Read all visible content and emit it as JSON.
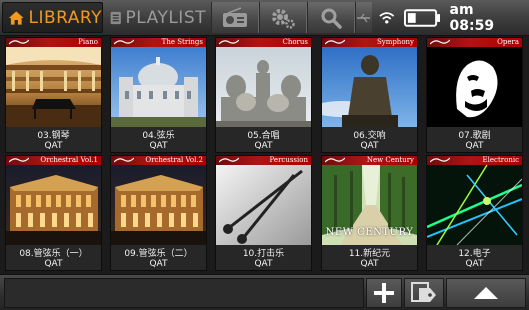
{
  "topbar": {
    "library_label": "LIBRARY",
    "playlist_label": "PLAYLIST",
    "icons": [
      "home-icon",
      "playlist-icon",
      "radio-icon",
      "settings-icon",
      "search-icon",
      "usb-icon"
    ],
    "time": "am 08:59",
    "wifi_icon": "wifi-icon",
    "battery_icon": "battery-icon"
  },
  "albums": [
    {
      "title": "Piano",
      "number": "03.钢琴",
      "artist": "QAT",
      "theme": "concert-hall"
    },
    {
      "title": "The Strings",
      "number": "04.弦乐",
      "artist": "QAT",
      "theme": "palace"
    },
    {
      "title": "Chorus",
      "number": "05.合唱",
      "artist": "QAT",
      "theme": "statues"
    },
    {
      "title": "Symphony",
      "number": "06.交响",
      "artist": "QAT",
      "theme": "statue-sky"
    },
    {
      "title": "Opera",
      "number": "07.歌剧",
      "artist": "QAT",
      "theme": "portrait"
    },
    {
      "title": "Orchestral Vol.1",
      "number": "08.管弦乐（一）",
      "artist": "QAT",
      "theme": "building-night"
    },
    {
      "title": "Orchestral Vol.2",
      "number": "09.管弦乐（二）",
      "artist": "QAT",
      "theme": "building-night"
    },
    {
      "title": "Percussion",
      "number": "10.打击乐",
      "artist": "QAT",
      "theme": "drumsticks"
    },
    {
      "title": "New Century",
      "number": "11.新纪元",
      "artist": "QAT",
      "theme": "forest-path",
      "cover_text": "NEW CENTURY"
    },
    {
      "title": "Electronic",
      "number": "12.电子",
      "artist": "QAT",
      "theme": "neon"
    }
  ],
  "bottombar": {
    "buttons": [
      "add-icon",
      "tag-icon",
      "up-arrow-icon"
    ]
  },
  "colors": {
    "accent": "#f29a1e",
    "banner": "#b01414"
  }
}
